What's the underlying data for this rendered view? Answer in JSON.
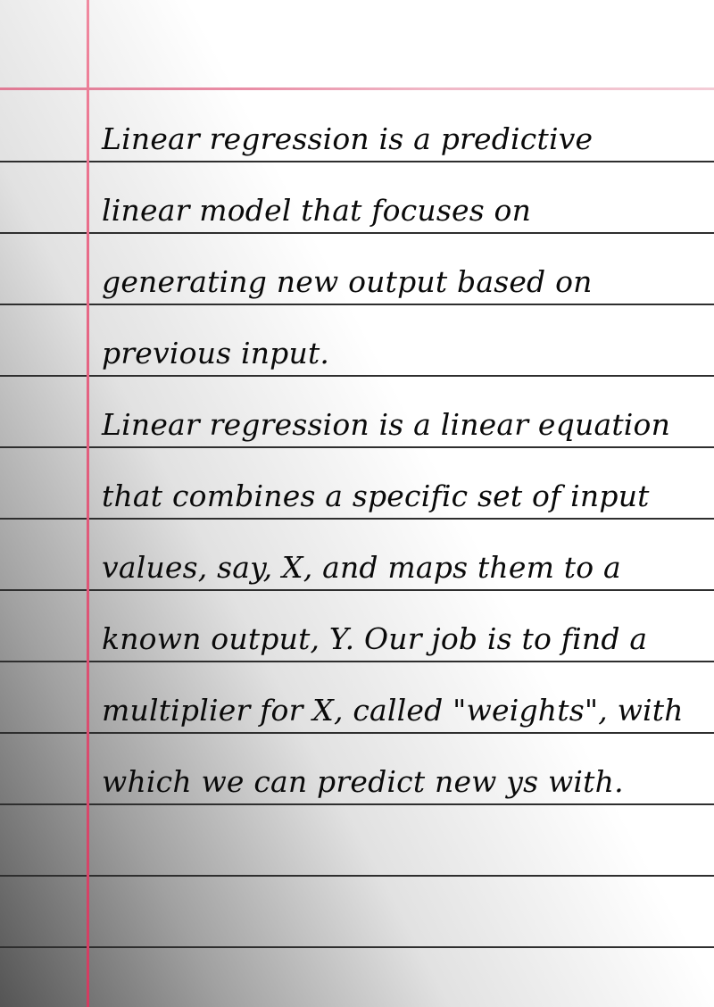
{
  "document": {
    "lines": [
      "Linear regression is a predictive",
      "linear model that focuses on",
      "generating new output based on",
      "previous input.",
      "Linear regression is a linear equation",
      "that combines a specific set of input",
      "values, say, X, and maps them to a",
      "known output, Y. Our job is to find a",
      "multiplier for X, called \"weights\", with",
      "which we can predict new ys with."
    ]
  },
  "colors": {
    "margin_line": "#d23b60",
    "rule_line": "#2e2e2e",
    "ink": "#0a0a0a"
  }
}
